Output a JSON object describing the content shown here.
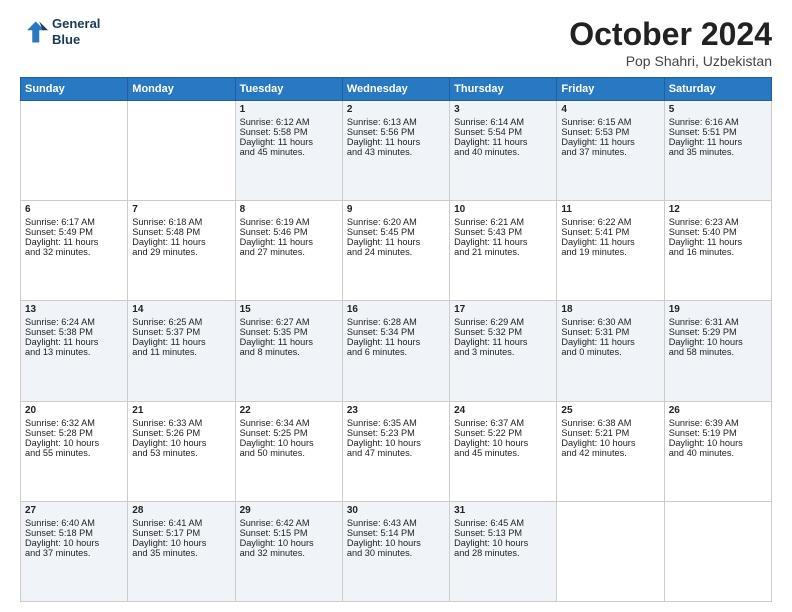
{
  "header": {
    "logo_line1": "General",
    "logo_line2": "Blue",
    "month": "October 2024",
    "location": "Pop Shahri, Uzbekistan"
  },
  "weekdays": [
    "Sunday",
    "Monday",
    "Tuesday",
    "Wednesday",
    "Thursday",
    "Friday",
    "Saturday"
  ],
  "weeks": [
    [
      {
        "day": "",
        "lines": []
      },
      {
        "day": "",
        "lines": []
      },
      {
        "day": "1",
        "lines": [
          "Sunrise: 6:12 AM",
          "Sunset: 5:58 PM",
          "Daylight: 11 hours",
          "and 45 minutes."
        ]
      },
      {
        "day": "2",
        "lines": [
          "Sunrise: 6:13 AM",
          "Sunset: 5:56 PM",
          "Daylight: 11 hours",
          "and 43 minutes."
        ]
      },
      {
        "day": "3",
        "lines": [
          "Sunrise: 6:14 AM",
          "Sunset: 5:54 PM",
          "Daylight: 11 hours",
          "and 40 minutes."
        ]
      },
      {
        "day": "4",
        "lines": [
          "Sunrise: 6:15 AM",
          "Sunset: 5:53 PM",
          "Daylight: 11 hours",
          "and 37 minutes."
        ]
      },
      {
        "day": "5",
        "lines": [
          "Sunrise: 6:16 AM",
          "Sunset: 5:51 PM",
          "Daylight: 11 hours",
          "and 35 minutes."
        ]
      }
    ],
    [
      {
        "day": "6",
        "lines": [
          "Sunrise: 6:17 AM",
          "Sunset: 5:49 PM",
          "Daylight: 11 hours",
          "and 32 minutes."
        ]
      },
      {
        "day": "7",
        "lines": [
          "Sunrise: 6:18 AM",
          "Sunset: 5:48 PM",
          "Daylight: 11 hours",
          "and 29 minutes."
        ]
      },
      {
        "day": "8",
        "lines": [
          "Sunrise: 6:19 AM",
          "Sunset: 5:46 PM",
          "Daylight: 11 hours",
          "and 27 minutes."
        ]
      },
      {
        "day": "9",
        "lines": [
          "Sunrise: 6:20 AM",
          "Sunset: 5:45 PM",
          "Daylight: 11 hours",
          "and 24 minutes."
        ]
      },
      {
        "day": "10",
        "lines": [
          "Sunrise: 6:21 AM",
          "Sunset: 5:43 PM",
          "Daylight: 11 hours",
          "and 21 minutes."
        ]
      },
      {
        "day": "11",
        "lines": [
          "Sunrise: 6:22 AM",
          "Sunset: 5:41 PM",
          "Daylight: 11 hours",
          "and 19 minutes."
        ]
      },
      {
        "day": "12",
        "lines": [
          "Sunrise: 6:23 AM",
          "Sunset: 5:40 PM",
          "Daylight: 11 hours",
          "and 16 minutes."
        ]
      }
    ],
    [
      {
        "day": "13",
        "lines": [
          "Sunrise: 6:24 AM",
          "Sunset: 5:38 PM",
          "Daylight: 11 hours",
          "and 13 minutes."
        ]
      },
      {
        "day": "14",
        "lines": [
          "Sunrise: 6:25 AM",
          "Sunset: 5:37 PM",
          "Daylight: 11 hours",
          "and 11 minutes."
        ]
      },
      {
        "day": "15",
        "lines": [
          "Sunrise: 6:27 AM",
          "Sunset: 5:35 PM",
          "Daylight: 11 hours",
          "and 8 minutes."
        ]
      },
      {
        "day": "16",
        "lines": [
          "Sunrise: 6:28 AM",
          "Sunset: 5:34 PM",
          "Daylight: 11 hours",
          "and 6 minutes."
        ]
      },
      {
        "day": "17",
        "lines": [
          "Sunrise: 6:29 AM",
          "Sunset: 5:32 PM",
          "Daylight: 11 hours",
          "and 3 minutes."
        ]
      },
      {
        "day": "18",
        "lines": [
          "Sunrise: 6:30 AM",
          "Sunset: 5:31 PM",
          "Daylight: 11 hours",
          "and 0 minutes."
        ]
      },
      {
        "day": "19",
        "lines": [
          "Sunrise: 6:31 AM",
          "Sunset: 5:29 PM",
          "Daylight: 10 hours",
          "and 58 minutes."
        ]
      }
    ],
    [
      {
        "day": "20",
        "lines": [
          "Sunrise: 6:32 AM",
          "Sunset: 5:28 PM",
          "Daylight: 10 hours",
          "and 55 minutes."
        ]
      },
      {
        "day": "21",
        "lines": [
          "Sunrise: 6:33 AM",
          "Sunset: 5:26 PM",
          "Daylight: 10 hours",
          "and 53 minutes."
        ]
      },
      {
        "day": "22",
        "lines": [
          "Sunrise: 6:34 AM",
          "Sunset: 5:25 PM",
          "Daylight: 10 hours",
          "and 50 minutes."
        ]
      },
      {
        "day": "23",
        "lines": [
          "Sunrise: 6:35 AM",
          "Sunset: 5:23 PM",
          "Daylight: 10 hours",
          "and 47 minutes."
        ]
      },
      {
        "day": "24",
        "lines": [
          "Sunrise: 6:37 AM",
          "Sunset: 5:22 PM",
          "Daylight: 10 hours",
          "and 45 minutes."
        ]
      },
      {
        "day": "25",
        "lines": [
          "Sunrise: 6:38 AM",
          "Sunset: 5:21 PM",
          "Daylight: 10 hours",
          "and 42 minutes."
        ]
      },
      {
        "day": "26",
        "lines": [
          "Sunrise: 6:39 AM",
          "Sunset: 5:19 PM",
          "Daylight: 10 hours",
          "and 40 minutes."
        ]
      }
    ],
    [
      {
        "day": "27",
        "lines": [
          "Sunrise: 6:40 AM",
          "Sunset: 5:18 PM",
          "Daylight: 10 hours",
          "and 37 minutes."
        ]
      },
      {
        "day": "28",
        "lines": [
          "Sunrise: 6:41 AM",
          "Sunset: 5:17 PM",
          "Daylight: 10 hours",
          "and 35 minutes."
        ]
      },
      {
        "day": "29",
        "lines": [
          "Sunrise: 6:42 AM",
          "Sunset: 5:15 PM",
          "Daylight: 10 hours",
          "and 32 minutes."
        ]
      },
      {
        "day": "30",
        "lines": [
          "Sunrise: 6:43 AM",
          "Sunset: 5:14 PM",
          "Daylight: 10 hours",
          "and 30 minutes."
        ]
      },
      {
        "day": "31",
        "lines": [
          "Sunrise: 6:45 AM",
          "Sunset: 5:13 PM",
          "Daylight: 10 hours",
          "and 28 minutes."
        ]
      },
      {
        "day": "",
        "lines": []
      },
      {
        "day": "",
        "lines": []
      }
    ]
  ]
}
